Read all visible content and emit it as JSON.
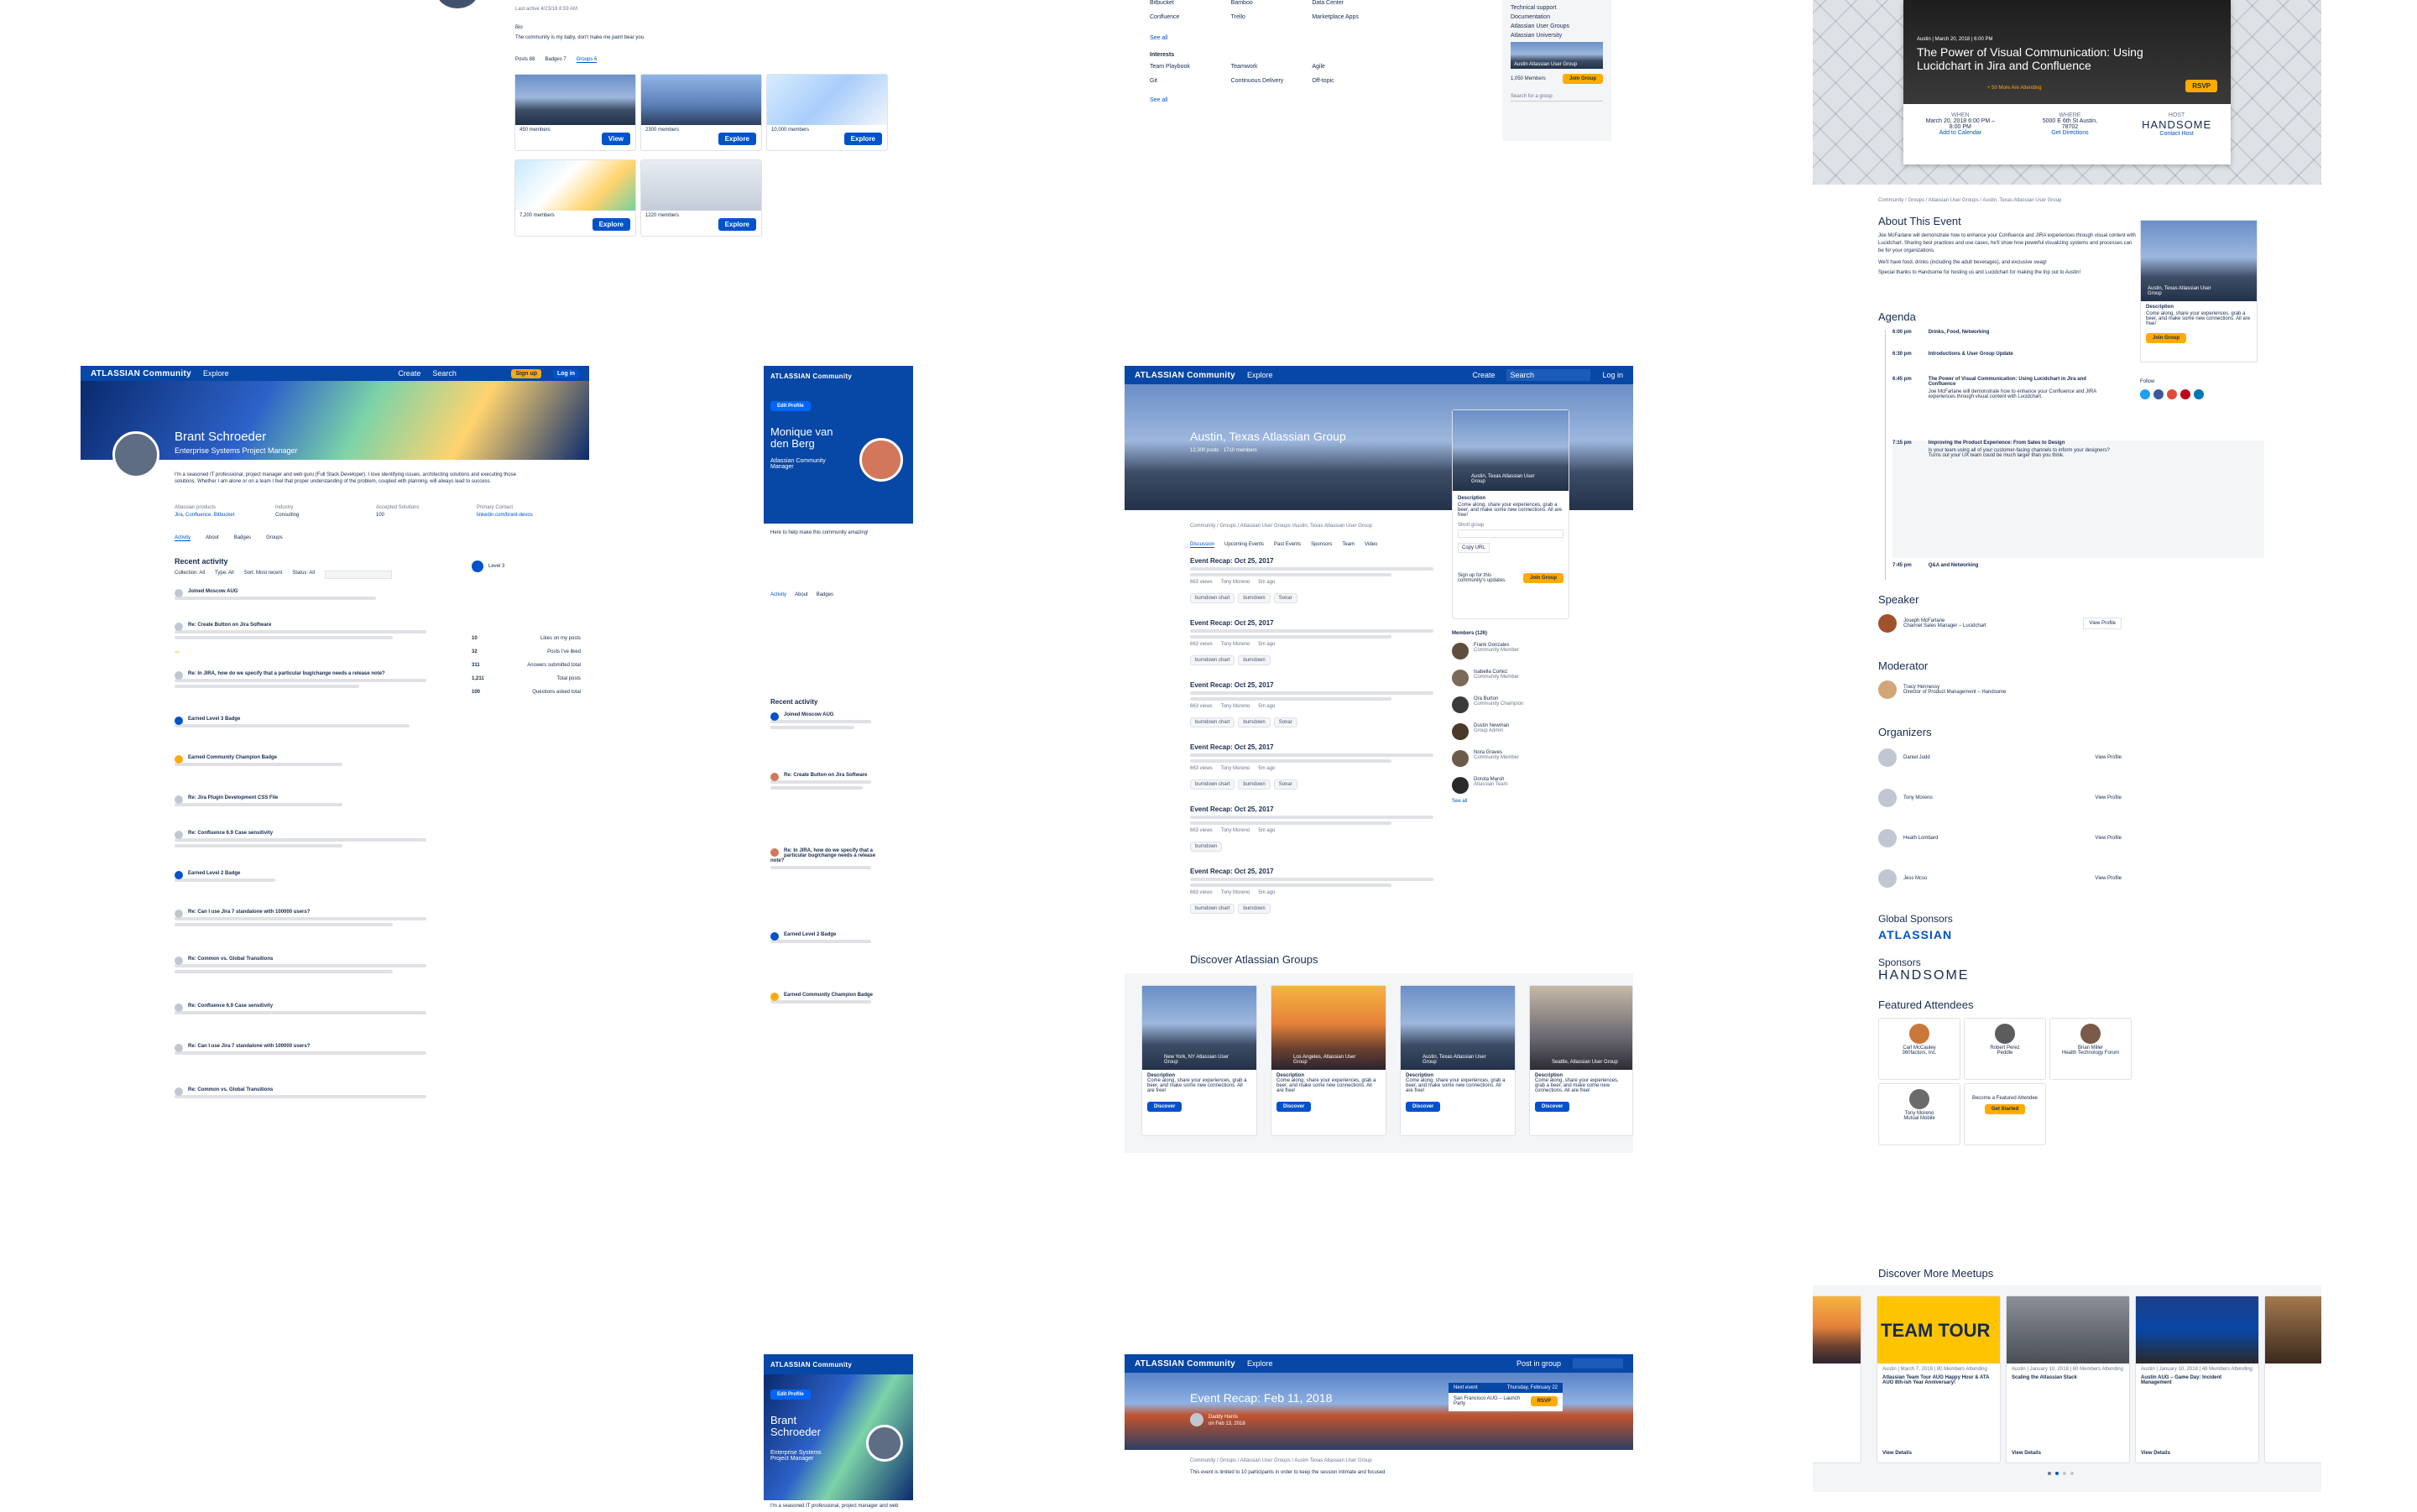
{
  "brand": {
    "logo": "ATLASSIAN Community",
    "blue": "#0747a6",
    "accent": "#0052cc",
    "yellow": "#ffab00"
  },
  "top_profile": {
    "last_active": "Last active 4/23/18 8:59 AM",
    "bio_label": "Bio",
    "bio": "The community is my baby, don't make me paint bear you.",
    "tabs": [
      "Posts 88",
      "Badges 7",
      "Groups 6"
    ],
    "groups": [
      {
        "name": "Austin",
        "members": "450 members",
        "action": "View"
      },
      {
        "name": "",
        "members": "2300 members",
        "action": "Explore"
      },
      {
        "name": "",
        "members": "10,000 members",
        "action": "Explore"
      },
      {
        "name": "",
        "members": "7,200 members",
        "action": "Explore"
      },
      {
        "name": "",
        "members": "1220 members",
        "action": "Explore"
      }
    ]
  },
  "groups_dir": {
    "products": [
      "Bitbucket",
      "Bamboo",
      "Data Center",
      "Confluence",
      "Trello",
      "Marketplace Apps"
    ],
    "see_all": "See all",
    "interests_label": "Interests",
    "interests": [
      "Team Playbook",
      "Teamwork",
      "Agile",
      "Git",
      "Continuous Delivery",
      "Off-topic"
    ],
    "side_links": [
      "Technical support",
      "Documentation",
      "Atlassian User Groups",
      "Atlassian University"
    ],
    "featured_group": "Austin Atlassian User Group",
    "members": "1,050 Members",
    "join": "Join Group",
    "search_placeholder": "Search for a group"
  },
  "event": {
    "city_date": "Austin | March 20, 2018 | 6:00 PM",
    "title": "The Power of Visual Communication: Using Lucidchart in Jira and Confluence",
    "attending": "+ 50 More Are Attending",
    "rsvp": "RSVP",
    "when_label": "WHEN",
    "when": "March 20, 2018 6:00 PM – 8:00 PM",
    "add_cal": "Add to Calendar",
    "where_label": "WHERE",
    "where": "5000 E 6th St Austin, 78702",
    "directions": "Get Directions",
    "host_label": "HOST",
    "host": "HANDSOME",
    "contact": "Contact Host",
    "breadcrumb": "Community / Groups / Atlassian User Groups / Austin, Texas Atlassian User Group",
    "about_title": "About This Event",
    "about": "Joe McFarlane will demonstrate how to enhance your Confluence and JIRA experiences through visual content with Lucidchart. Sharing best practices and use cases, he'll show how powerful visualizing systems and processes can be for your organizations.",
    "about2": "We'll have food, drinks (including the adult beverages), and exclusive swag!",
    "about3": "Special thanks to Handsome for hosting us and Lucidchart for making the trip out to Austin!",
    "group_card": "Austin, Texas Atlassian User Group",
    "group_desc_label": "Description",
    "group_desc": "Come along, share your experiences, grab a beer, and make some new connections. All are free!",
    "join_group": "Join Group",
    "follow": "Follow",
    "agenda_title": "Agenda",
    "agenda": [
      {
        "time": "6:00 pm",
        "title": "Drinks, Food, Networking",
        "desc": ""
      },
      {
        "time": "6:30 pm",
        "title": "Introductions & User Group Update",
        "desc": ""
      },
      {
        "time": "6:45 pm",
        "title": "The Power of Visual Communication: Using Lucidchart in Jira and Confluence",
        "desc": "Joe McFarlane will demonstrate how to enhance your Confluence and JIRA experiences through visual content with Lucidchart."
      },
      {
        "time": "7:15 pm",
        "title": "Improving the Product Experience: From Sales to Design",
        "desc": "Is your team using all of your customer-facing channels to inform your designers? Turns out your UX team could be much larger than you think."
      },
      {
        "time": "7:45 pm",
        "title": "Q&A and Networking",
        "desc": ""
      }
    ],
    "speaker_title": "Speaker",
    "speaker": {
      "name": "Joseph McFarlane",
      "role": "Channel Sales Manager – Lucidchart",
      "action": "View Profile"
    },
    "moderator_title": "Moderator",
    "moderator": {
      "name": "Tracy Hennessy",
      "role": "Director of Product Management – Handsome"
    },
    "organizers_title": "Organizers",
    "organizers": [
      {
        "name": "Daniel Judd",
        "action": "View Profile"
      },
      {
        "name": "Tony Moreno",
        "action": "View Profile"
      },
      {
        "name": "Heath Lombard",
        "action": "View Profile"
      },
      {
        "name": "Jess Mcso",
        "action": "View Profile"
      }
    ],
    "global_sponsors": "Global Sponsors",
    "global_sponsor": "ATLASSIAN",
    "sponsors": "Sponsors",
    "sponsor": "HANDSOME",
    "featured_title": "Featured Attendees",
    "attendees": [
      {
        "name": "Carl McCauley",
        "org": "360factors, Inc."
      },
      {
        "name": "Robert Perez",
        "org": "Peddle"
      },
      {
        "name": "Brian Miller",
        "org": "Health Technology Forum"
      },
      {
        "name": "Tony Moreno",
        "org": "Mutual Mobile"
      }
    ],
    "become": "Become a Featured Attendee",
    "get_started": "Get Started",
    "discover_title": "Discover More Meetups",
    "meetups": [
      {
        "title": "Atlassian Team Tour AUG Happy Hour & ATA AUG 8th-ish Year Anniversary!",
        "meta": "Austin | March 7, 2018 | 80 Members Attending",
        "banner": "TEAM TOUR",
        "action": "View Details"
      },
      {
        "title": "Scaling the Atlassian Stack",
        "meta": "Austin | January 10, 2018 | 60 Members Attending",
        "banner": "",
        "action": "View Details"
      },
      {
        "title": "Austin AUG – Game Day: Incident Management",
        "meta": "Austin | January 10, 2018 | 48 Members Attending",
        "banner": "",
        "action": "View Details"
      }
    ]
  },
  "profile_desktop": {
    "nav": [
      "Explore",
      "Create",
      "Search",
      "Sign up",
      "Log in"
    ],
    "name": "Brant Schroeder",
    "title": "Enterprise Systems Project Manager",
    "bio": "I'm a seasoned IT professional, project manager and web guru (Full Stack Developer). I love identifying issues, architecting solutions and executing those solutions. Whether I am alone or on a team I feel that proper understanding of the problem, coupled with planning, will always lead to success.",
    "products_label": "Atlassian products",
    "products": "Jira, Confluence, Bitbucket",
    "industry_label": "Industry",
    "industry": "Consulting",
    "acc_label": "Accepted Solutions",
    "acc": "100",
    "contact_label": "Primary Contact",
    "contact": "linkedin.com/brant-devos",
    "tabs": [
      "Activity",
      "About",
      "Badges",
      "Groups"
    ],
    "recent": "Recent activity",
    "filters": [
      "Collection: All",
      "Type: All",
      "Sort: Most recent",
      "Status: All"
    ],
    "latest_badge": "Level 3",
    "stats": [
      {
        "n": "10",
        "l": "Likes on my posts"
      },
      {
        "n": "32",
        "l": "Posts I've liked"
      },
      {
        "n": "311",
        "l": "Answers submitted total"
      },
      {
        "n": "1,211",
        "l": "Total posts"
      },
      {
        "n": "100",
        "l": "Questions asked total"
      }
    ],
    "activity": [
      "Joined Moscow AUG",
      "Re: Create Button on Jira Software",
      "Re: In JIRA, how do we specify that a particular bug/change needs a release note?",
      "Earned Level 3 Badge",
      "Earned Community Champion Badge",
      "Re: Jira Plugin Development CSS File",
      "Re: Confluence 6.9 Case sensitivity",
      "Earned Level 2 Badge",
      "Re: Can I use Jira 7 standalone with 100000 users?",
      "Re: Common vs. Global Transitions",
      "Re: Confluence 6.9 Case sensitivity",
      "Re: Can I use Jira 7 standalone with 100000 users?",
      "Re: Common vs. Global Transitions"
    ]
  },
  "profile_mobile": {
    "edit": "Edit Profile",
    "name": "Monique van den Berg",
    "role": "Atlassian Community Manager",
    "bio": "Here to help make this community amazing!",
    "tabs": [
      "Activity",
      "About",
      "Badges"
    ],
    "recent": "Recent activity",
    "activity": [
      "Joined Moscow AUG",
      "Re: Create Button on Jira Software",
      "Re: In JIRA, how do we specify that a particular bug/change needs a release note?",
      "Earned Level 2 Badge",
      "Earned Community Champion Badge"
    ]
  },
  "group_page": {
    "nav": [
      "Explore",
      "Create",
      "Search",
      "Log in"
    ],
    "name": "Austin, Texas Atlassian Group",
    "stats": "12,300 posts · 1710 members",
    "card_name": "Austin, Texas Atlassian User Group",
    "desc_label": "Description",
    "desc": "Come along, share your experiences, grab a beer, and make some new connections. All are free!",
    "short_link_label": "Short group",
    "copy_url": "Copy URL",
    "signup": "Sign up for this community's updates.",
    "join": "Join Group",
    "members_label": "Members (126)",
    "members": [
      {
        "name": "Frank Gonzales",
        "role": "Community Member"
      },
      {
        "name": "Isabella Cortez",
        "role": "Community Member"
      },
      {
        "name": "Ora Burton",
        "role": "Community Champion"
      },
      {
        "name": "Dustin Newman",
        "role": "Group Admin"
      },
      {
        "name": "Nora Graves",
        "role": "Community Member"
      },
      {
        "name": "Dorota Marsh",
        "role": "Atlassian Team"
      }
    ],
    "see_all": "See all",
    "breadcrumb": "Community / Groups / Atlassian User Groups /Austin, Texas Atlassian User Group",
    "tabs": [
      "Discussion",
      "Upcoming Events",
      "Past Events",
      "Sponsors",
      "Team",
      "Video"
    ],
    "posts": [
      {
        "title": "Event Recap: Oct 25, 2017",
        "views": "663 views",
        "tags": [
          "burndown chart",
          "burndown",
          "Sonar"
        ]
      },
      {
        "title": "Event Recap: Oct 25, 2017",
        "views": "663 views",
        "tags": [
          "burndown chart",
          "burndown"
        ]
      },
      {
        "title": "Event Recap: Oct 25, 2017",
        "views": "663 views",
        "tags": [
          "burndown chart",
          "burndown",
          "Sonar"
        ]
      },
      {
        "title": "Event Recap: Oct 25, 2017",
        "views": "663 views",
        "tags": [
          "burndown chart",
          "burndown",
          "Sonar"
        ]
      },
      {
        "title": "Event Recap: Oct 25, 2017",
        "views": "663 views",
        "tags": [
          "burndown"
        ]
      },
      {
        "title": "Event Recap: Oct 25, 2017",
        "views": "663 views",
        "tags": [
          "burndown chart",
          "burndown"
        ]
      }
    ],
    "post_author": "Tony Moreno",
    "post_time": "5m ago",
    "discover_title": "Discover Atlassian Groups",
    "discover": [
      {
        "name": "New York, NY Atlassian User Group",
        "action": "Discover"
      },
      {
        "name": "Los Angeles, Atlassian User Group",
        "action": "Discover"
      },
      {
        "name": "Austin, Texas Atlassian User Group",
        "action": "Discover"
      },
      {
        "name": "Seattle, Atlassian User Group",
        "action": "Discover"
      }
    ],
    "discover_desc_label": "Description",
    "discover_desc": "Come along, share your experiences, grab a beer, and make some new connections. All are free!"
  },
  "mobile_bottom": {
    "edit": "Edit Profile",
    "name": "Brant Schroeder",
    "role": "Enterprise Systems Project Manager",
    "bio": "I'm a seasoned IT professional, project manager and web"
  },
  "recap_page": {
    "nav": [
      "Explore",
      "Post in group"
    ],
    "title": "Event Recap: Feb 11, 2018",
    "author": "Daddy Harris",
    "date": "on Feb 13, 2018",
    "next_label": "Next event",
    "next_date": "Thursday, February 22",
    "next_name": "San Francisco AUG – Launch Party",
    "rsvp": "RSVP",
    "breadcrumb": "Community / Groups / Atlassian User Groups / Austin Texas Atlassian User Group",
    "line": "This event is limited to 10 participants in order to keep the session intimate and focused"
  }
}
